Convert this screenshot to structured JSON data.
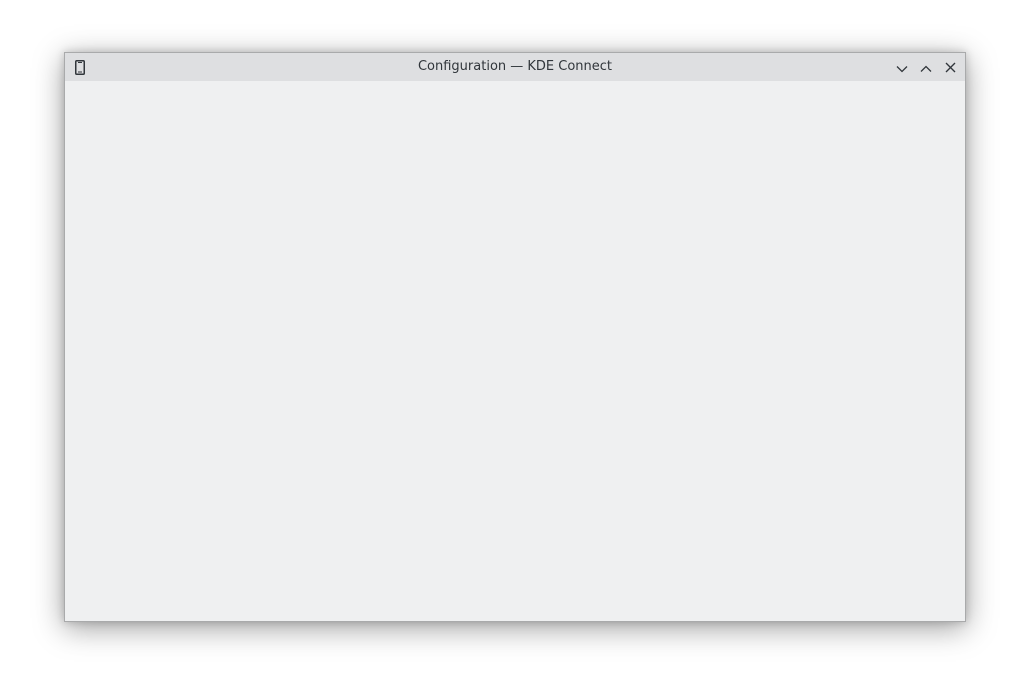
{
  "window": {
    "title": "Configuration — KDE Connect",
    "app_icon": "smartphone-icon",
    "controls": {
      "minimize_icon": "chevron-down-icon",
      "maximize_icon": "chevron-up-icon",
      "close_icon": "close-icon"
    }
  },
  "colors": {
    "titlebar": "#dedfe1",
    "content": "#eff0f1",
    "text": "#31363b"
  }
}
